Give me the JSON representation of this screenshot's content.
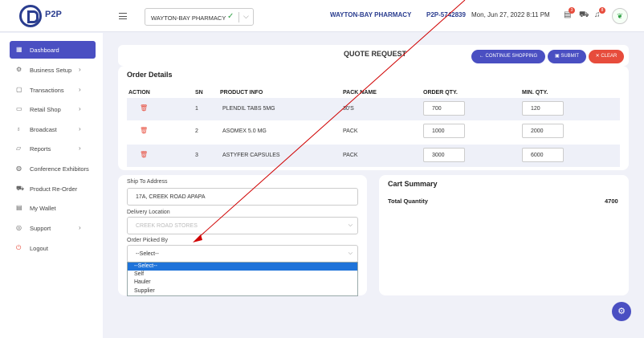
{
  "app": {
    "logo_text": "P2P"
  },
  "header": {
    "pharmacy_select_value": "WAYTON-BAY PHARMACY",
    "pharmacy_name": "WAYTON-BAY PHARMACY",
    "account_code": "P2P-5742839",
    "datetime": "Mon, Jun 27, 2022 8:11 PM",
    "orders_badge": "3",
    "cart_badge": "",
    "notif_badge": "8"
  },
  "sidebar": {
    "items": [
      {
        "label": "Dashboard",
        "icon": "grid-icon",
        "active": true,
        "has_arrow": false
      },
      {
        "label": "Business Setup",
        "icon": "gear-icon",
        "has_arrow": true
      },
      {
        "label": "Transactions",
        "icon": "copy-icon",
        "has_arrow": true
      },
      {
        "label": "Retail Shop",
        "icon": "shop-icon",
        "has_arrow": true
      },
      {
        "label": "Broadcast",
        "icon": "mic-icon",
        "has_arrow": true
      },
      {
        "label": "Reports",
        "icon": "folder-icon",
        "has_arrow": true
      },
      {
        "label": "Conference Exhibitors",
        "icon": "globe-icon",
        "has_arrow": false
      },
      {
        "label": "Product Re-Order",
        "icon": "cart-icon",
        "has_arrow": false
      },
      {
        "label": "My Wallet",
        "icon": "wallet-icon",
        "has_arrow": false
      },
      {
        "label": "Support",
        "icon": "support-icon",
        "has_arrow": true
      },
      {
        "label": "Logout",
        "icon": "power-icon",
        "has_arrow": false
      }
    ]
  },
  "page": {
    "title": "QUOTE REQUEST",
    "continue_label": "CONTINUE SHOPPING",
    "submit_label": "SUBMIT",
    "clear_label": "CLEAR"
  },
  "order_details": {
    "title": "Order Details",
    "columns": [
      "ACTION",
      "SN",
      "PRODUCT INFO",
      "PACK NAME",
      "ORDER QTY.",
      "MIN. QTY."
    ],
    "rows": [
      {
        "sn": "1",
        "product": "PLENDIL TABS 5MG",
        "pack": "30'S",
        "order_qty": "700",
        "min_qty": "120"
      },
      {
        "sn": "2",
        "product": "ASOMEX 5.0 MG",
        "pack": "PACK",
        "order_qty": "1000",
        "min_qty": "2000"
      },
      {
        "sn": "3",
        "product": "ASTYFER CAPSULES",
        "pack": "PACK",
        "order_qty": "3000",
        "min_qty": "6000"
      }
    ]
  },
  "shipping": {
    "ship_to_label": "Ship To Address",
    "ship_to_value": "17A, CREEK ROAD APAPA",
    "delivery_label": "Delivery Location",
    "delivery_value": "CREEK ROAD STORES",
    "picked_by_label": "Order Picked By",
    "picked_by_value": "--Select--",
    "picked_by_options": [
      "--Select--",
      "Self",
      "Hauler",
      "Supplier"
    ]
  },
  "cart_summary": {
    "title": "Cart Summary",
    "total_qty_label": "Total Quantity",
    "total_qty_value": "4700"
  },
  "colors": {
    "primary": "#4a4fc2",
    "danger": "#e74c3c",
    "brand": "#2a3d8f",
    "annotation_arrow": "#d00000"
  }
}
